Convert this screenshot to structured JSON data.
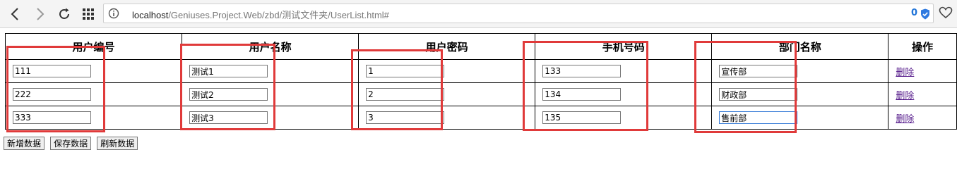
{
  "browser": {
    "url_host": "localhost",
    "url_path": "/Geniuses.Project.Web/zbd/测试文件夹/UserList.html#",
    "badge_count": "0"
  },
  "table": {
    "headers": [
      "用户编号",
      "用户名称",
      "用户密码",
      "手机号码",
      "部门名称",
      "操作"
    ],
    "rows": [
      {
        "id": "111",
        "name": "测试1",
        "password": "1",
        "phone": "133",
        "dept": "宣传部",
        "action": "删除"
      },
      {
        "id": "222",
        "name": "测试2",
        "password": "2",
        "phone": "134",
        "dept": "财政部",
        "action": "删除"
      },
      {
        "id": "333",
        "name": "测试3",
        "password": "3",
        "phone": "135",
        "dept": "售前部",
        "action": "删除"
      }
    ]
  },
  "buttons": {
    "add": "新增数据",
    "save": "保存数据",
    "refresh": "刷新数据"
  },
  "colors": {
    "annotation": "#e03a3a",
    "link": "#551a8b"
  }
}
